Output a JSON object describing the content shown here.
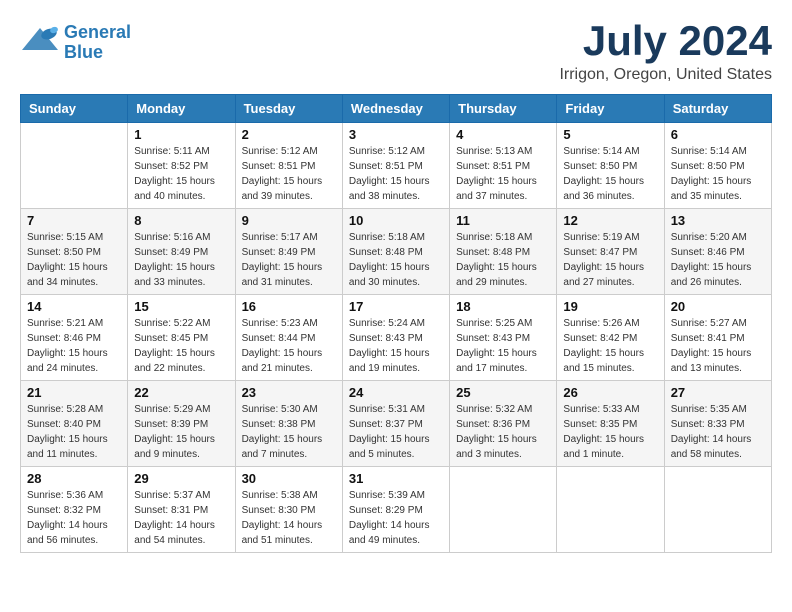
{
  "header": {
    "logo_line1": "General",
    "logo_line2": "Blue",
    "month": "July 2024",
    "location": "Irrigon, Oregon, United States"
  },
  "weekdays": [
    "Sunday",
    "Monday",
    "Tuesday",
    "Wednesday",
    "Thursday",
    "Friday",
    "Saturday"
  ],
  "weeks": [
    [
      {
        "day": null,
        "info": null
      },
      {
        "day": "1",
        "info": "Sunrise: 5:11 AM\nSunset: 8:52 PM\nDaylight: 15 hours\nand 40 minutes."
      },
      {
        "day": "2",
        "info": "Sunrise: 5:12 AM\nSunset: 8:51 PM\nDaylight: 15 hours\nand 39 minutes."
      },
      {
        "day": "3",
        "info": "Sunrise: 5:12 AM\nSunset: 8:51 PM\nDaylight: 15 hours\nand 38 minutes."
      },
      {
        "day": "4",
        "info": "Sunrise: 5:13 AM\nSunset: 8:51 PM\nDaylight: 15 hours\nand 37 minutes."
      },
      {
        "day": "5",
        "info": "Sunrise: 5:14 AM\nSunset: 8:50 PM\nDaylight: 15 hours\nand 36 minutes."
      },
      {
        "day": "6",
        "info": "Sunrise: 5:14 AM\nSunset: 8:50 PM\nDaylight: 15 hours\nand 35 minutes."
      }
    ],
    [
      {
        "day": "7",
        "info": "Sunrise: 5:15 AM\nSunset: 8:50 PM\nDaylight: 15 hours\nand 34 minutes."
      },
      {
        "day": "8",
        "info": "Sunrise: 5:16 AM\nSunset: 8:49 PM\nDaylight: 15 hours\nand 33 minutes."
      },
      {
        "day": "9",
        "info": "Sunrise: 5:17 AM\nSunset: 8:49 PM\nDaylight: 15 hours\nand 31 minutes."
      },
      {
        "day": "10",
        "info": "Sunrise: 5:18 AM\nSunset: 8:48 PM\nDaylight: 15 hours\nand 30 minutes."
      },
      {
        "day": "11",
        "info": "Sunrise: 5:18 AM\nSunset: 8:48 PM\nDaylight: 15 hours\nand 29 minutes."
      },
      {
        "day": "12",
        "info": "Sunrise: 5:19 AM\nSunset: 8:47 PM\nDaylight: 15 hours\nand 27 minutes."
      },
      {
        "day": "13",
        "info": "Sunrise: 5:20 AM\nSunset: 8:46 PM\nDaylight: 15 hours\nand 26 minutes."
      }
    ],
    [
      {
        "day": "14",
        "info": "Sunrise: 5:21 AM\nSunset: 8:46 PM\nDaylight: 15 hours\nand 24 minutes."
      },
      {
        "day": "15",
        "info": "Sunrise: 5:22 AM\nSunset: 8:45 PM\nDaylight: 15 hours\nand 22 minutes."
      },
      {
        "day": "16",
        "info": "Sunrise: 5:23 AM\nSunset: 8:44 PM\nDaylight: 15 hours\nand 21 minutes."
      },
      {
        "day": "17",
        "info": "Sunrise: 5:24 AM\nSunset: 8:43 PM\nDaylight: 15 hours\nand 19 minutes."
      },
      {
        "day": "18",
        "info": "Sunrise: 5:25 AM\nSunset: 8:43 PM\nDaylight: 15 hours\nand 17 minutes."
      },
      {
        "day": "19",
        "info": "Sunrise: 5:26 AM\nSunset: 8:42 PM\nDaylight: 15 hours\nand 15 minutes."
      },
      {
        "day": "20",
        "info": "Sunrise: 5:27 AM\nSunset: 8:41 PM\nDaylight: 15 hours\nand 13 minutes."
      }
    ],
    [
      {
        "day": "21",
        "info": "Sunrise: 5:28 AM\nSunset: 8:40 PM\nDaylight: 15 hours\nand 11 minutes."
      },
      {
        "day": "22",
        "info": "Sunrise: 5:29 AM\nSunset: 8:39 PM\nDaylight: 15 hours\nand 9 minutes."
      },
      {
        "day": "23",
        "info": "Sunrise: 5:30 AM\nSunset: 8:38 PM\nDaylight: 15 hours\nand 7 minutes."
      },
      {
        "day": "24",
        "info": "Sunrise: 5:31 AM\nSunset: 8:37 PM\nDaylight: 15 hours\nand 5 minutes."
      },
      {
        "day": "25",
        "info": "Sunrise: 5:32 AM\nSunset: 8:36 PM\nDaylight: 15 hours\nand 3 minutes."
      },
      {
        "day": "26",
        "info": "Sunrise: 5:33 AM\nSunset: 8:35 PM\nDaylight: 15 hours\nand 1 minute."
      },
      {
        "day": "27",
        "info": "Sunrise: 5:35 AM\nSunset: 8:33 PM\nDaylight: 14 hours\nand 58 minutes."
      }
    ],
    [
      {
        "day": "28",
        "info": "Sunrise: 5:36 AM\nSunset: 8:32 PM\nDaylight: 14 hours\nand 56 minutes."
      },
      {
        "day": "29",
        "info": "Sunrise: 5:37 AM\nSunset: 8:31 PM\nDaylight: 14 hours\nand 54 minutes."
      },
      {
        "day": "30",
        "info": "Sunrise: 5:38 AM\nSunset: 8:30 PM\nDaylight: 14 hours\nand 51 minutes."
      },
      {
        "day": "31",
        "info": "Sunrise: 5:39 AM\nSunset: 8:29 PM\nDaylight: 14 hours\nand 49 minutes."
      },
      {
        "day": null,
        "info": null
      },
      {
        "day": null,
        "info": null
      },
      {
        "day": null,
        "info": null
      }
    ]
  ]
}
